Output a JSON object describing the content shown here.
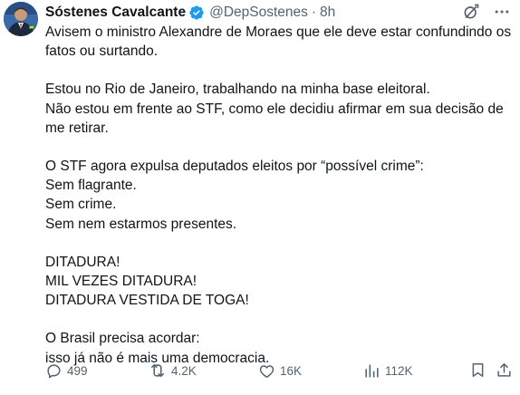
{
  "tweet": {
    "author_name": "Sóstenes Cavalcante",
    "handle": "@DepSostenes",
    "separator": "·",
    "time": "8h",
    "paragraphs": [
      [
        "Avisem o ministro Alexandre de Moraes que ele deve estar confundindo os",
        "fatos ou surtando."
      ],
      [
        "Estou no Rio de Janeiro, trabalhando na minha base eleitoral.",
        "Não estou em frente ao STF, como ele decidiu afirmar em sua decisão de",
        "me retirar."
      ],
      [
        "O STF agora expulsa deputados eleitos por “possível crime”:",
        "Sem flagrante.",
        "Sem crime.",
        "Sem nem estarmos presentes."
      ],
      [
        "DITADURA!",
        "MIL VEZES DITADURA!",
        "DITADURA VESTIDA DE TOGA!"
      ],
      [
        "O Brasil precisa acordar:",
        "isso já não é mais uma democracia."
      ]
    ],
    "stats": {
      "replies": "499",
      "reposts": "4.2K",
      "likes": "16K",
      "views": "112K"
    },
    "icons": {
      "verified": "verified-badge-icon",
      "grok": "grok-icon",
      "more": "more-icon",
      "reply": "reply-icon",
      "repost": "repost-icon",
      "like": "like-icon",
      "views": "views-icon",
      "bookmark": "bookmark-icon",
      "share": "share-icon"
    },
    "colors": {
      "verified": "#1d9bf0",
      "muted": "#536471",
      "text": "#0f1419"
    }
  }
}
